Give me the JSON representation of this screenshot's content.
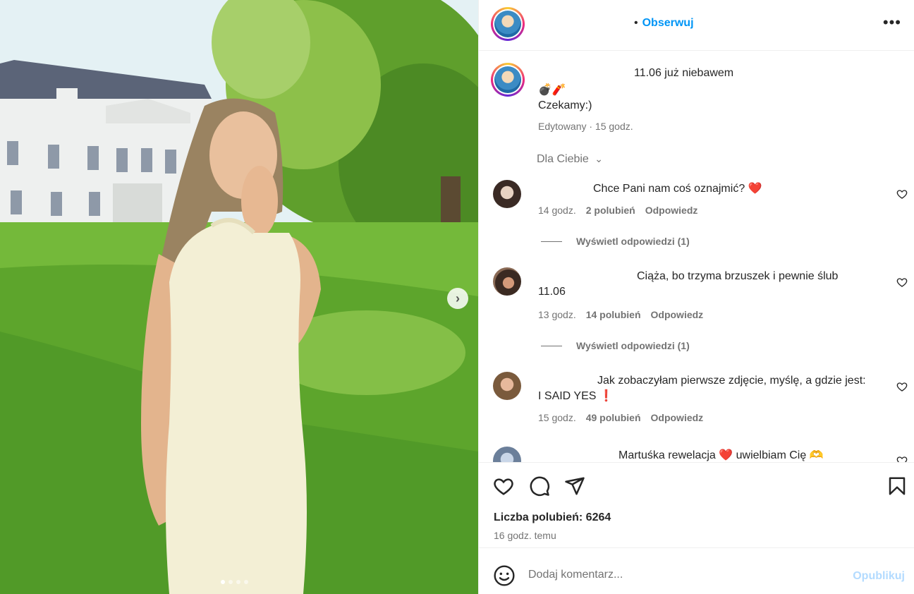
{
  "header": {
    "follow_label": "Obserwuj",
    "bullet": "•",
    "more_label": "•••"
  },
  "caption": {
    "title": "11.06 już niebawem",
    "emoji": "💣🧨",
    "text": "Czekamy:)",
    "meta": "Edytowany · 15 godz."
  },
  "filter": {
    "label": "Dla Ciebie",
    "chevron": "⌵"
  },
  "comments": [
    {
      "text": "Chce Pani nam coś oznajmić? ❤️",
      "time": "14 godz.",
      "likes": "2 polubień",
      "reply": "Odpowiedz",
      "view_replies": "Wyświetl odpowiedzi (1)"
    },
    {
      "text_line1": "Ciąża, bo trzyma brzuszek i pewnie ślub",
      "text_line2": "11.06",
      "time": "13 godz.",
      "likes": "14 polubień",
      "reply": "Odpowiedz",
      "view_replies": "Wyświetl odpowiedzi (1)"
    },
    {
      "text_line1": "Jak zobaczyłam pierwsze zdjęcie, myślę, a gdzie jest:",
      "text_line2": "I SAID YES ❗",
      "time": "15 godz.",
      "likes": "49 polubień",
      "reply": "Odpowiedz"
    },
    {
      "text": "Martuśka rewelacja ❤️ uwielbiam Cię 🫶"
    }
  ],
  "actions": {
    "likes": "Liczba polubień: 6264",
    "time": "16 godz. temu"
  },
  "add_comment": {
    "placeholder": "Dodaj komentarz...",
    "publish": "Opublikuj"
  },
  "carousel": {
    "next_icon": "›",
    "dot_count": 4,
    "active_dot": 1
  },
  "colors": {
    "link": "#0095f6",
    "muted": "#737373",
    "heart": "#ed4956",
    "publish_disabled": "#b3dbff"
  }
}
